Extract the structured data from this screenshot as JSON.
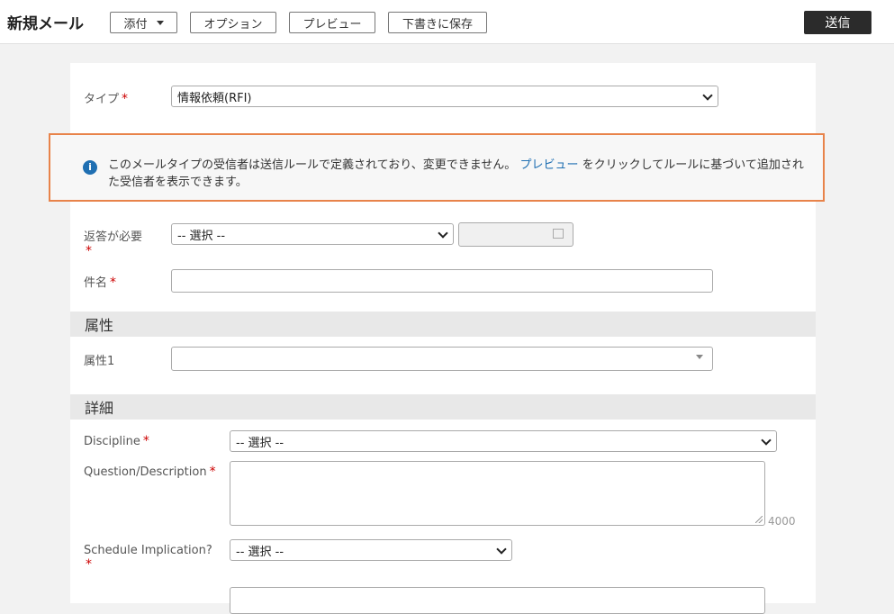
{
  "header": {
    "title": "新規メール",
    "attach_label": "添付",
    "options_label": "オプション",
    "preview_label": "プレビュー",
    "save_draft_label": "下書きに保存",
    "send_label": "送信"
  },
  "form": {
    "type": {
      "label": "タイプ",
      "value": "情報依頼(RFI)"
    },
    "info": {
      "text_before": "このメールタイプの受信者は送信ルールで定義されており、変更できません。",
      "link": "プレビュー",
      "text_after": "をクリックしてルールに基づいて追加された受信者を表示できます。"
    },
    "response_required": {
      "label": "返答が必要",
      "value": "-- 選択 --"
    },
    "subject": {
      "label": "件名",
      "value": ""
    },
    "attributes_section": "属性",
    "attribute1": {
      "label": "属性1",
      "value": ""
    },
    "details_section": "詳細",
    "discipline": {
      "label": "Discipline",
      "value": "-- 選択 --"
    },
    "question": {
      "label": "Question/Description",
      "value": "",
      "counter": "4000"
    },
    "schedule": {
      "label": "Schedule Implication?",
      "value": "-- 選択 --"
    }
  },
  "required_mark": "*"
}
